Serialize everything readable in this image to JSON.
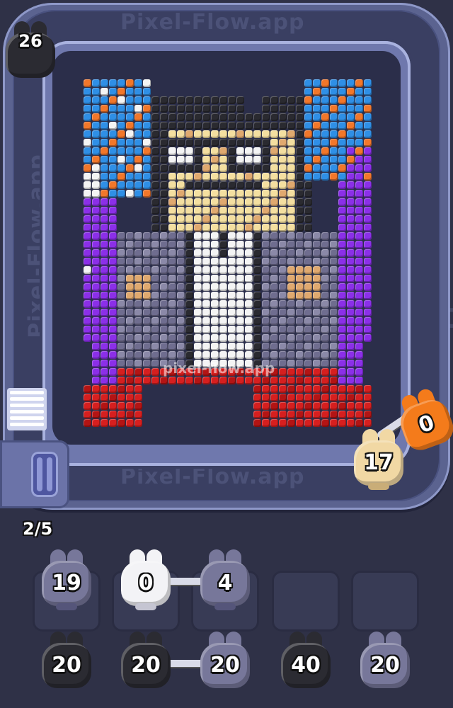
{
  "watermark_text": "Pixel-Flow.app",
  "art_watermark": "pixel-flow.app",
  "level_progress": "2/5",
  "top_counter": {
    "value": "26",
    "color": "#2b2b32"
  },
  "conveyor_shooters": [
    {
      "value": "17",
      "color": "cream"
    },
    {
      "value": "0",
      "color": "orange"
    }
  ],
  "queue_row_1": [
    {
      "value": "19",
      "color": "gray"
    },
    {
      "value": "0",
      "color": "white"
    },
    {
      "value": "4",
      "color": "gray"
    }
  ],
  "queue_row_2": [
    {
      "value": "20",
      "color": "black"
    },
    {
      "value": "20",
      "color": "black"
    },
    {
      "value": "20",
      "color": "gray"
    },
    {
      "value": "40",
      "color": "black"
    },
    {
      "value": "20",
      "color": "gray"
    }
  ],
  "palette": {
    "blue": "#2f8fe6",
    "orange": "#f2772a",
    "white": "#f4f4f4",
    "black": "#2a2a30",
    "cream": "#f4dfa0",
    "tan": "#e0a96f",
    "purple": "#8b2fe8",
    "gray": "#6f6d8f",
    "lightgray": "#8b89a8",
    "red": "#d61f1f",
    "darkred": "#b31414"
  }
}
